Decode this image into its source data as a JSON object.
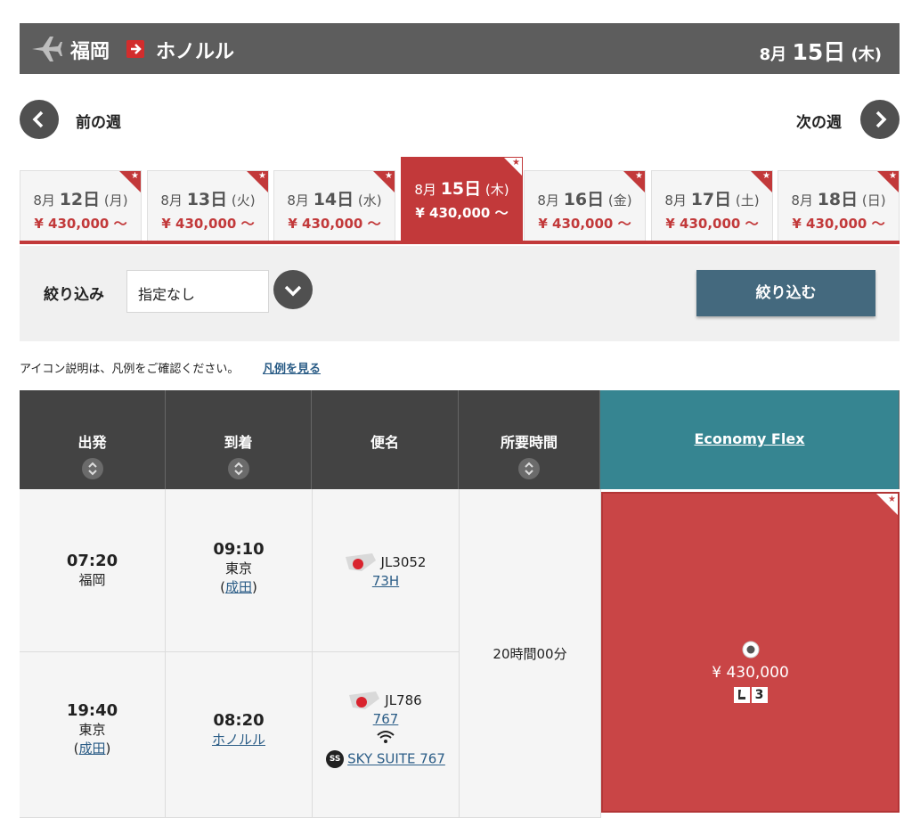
{
  "route": {
    "from": "福岡",
    "to": "ホノルル",
    "date_month": "8月",
    "date_day": "15日",
    "date_weekday": "(木)"
  },
  "week_nav": {
    "prev_label": "前の週",
    "next_label": "次の週"
  },
  "tabs": [
    {
      "month": "8月",
      "day": "12日",
      "weekday": "(月)",
      "price": "¥ 430,000 ～"
    },
    {
      "month": "8月",
      "day": "13日",
      "weekday": "(火)",
      "price": "¥ 430,000 ～"
    },
    {
      "month": "8月",
      "day": "14日",
      "weekday": "(水)",
      "price": "¥ 430,000 ～"
    },
    {
      "month": "8月",
      "day": "15日",
      "weekday": "(木)",
      "price": "¥ 430,000 ～"
    },
    {
      "month": "8月",
      "day": "16日",
      "weekday": "(金)",
      "price": "¥ 430,000 ～"
    },
    {
      "month": "8月",
      "day": "17日",
      "weekday": "(土)",
      "price": "¥ 430,000 ～"
    },
    {
      "month": "8月",
      "day": "18日",
      "weekday": "(日)",
      "price": "¥ 430,000 ～"
    }
  ],
  "filter": {
    "label": "絞り込み",
    "selected": "指定なし",
    "apply_label": "絞り込む"
  },
  "legend": {
    "text": "アイコン説明は、凡例をご確認ください。",
    "link": "凡例を見る"
  },
  "table": {
    "headers": {
      "depart": "出発",
      "arrive": "到着",
      "flight": "便名",
      "duration": "所要時間",
      "fare": "Economy Flex"
    },
    "segments": [
      {
        "depart_time": "07:20",
        "depart_city": "福岡",
        "arrive_time": "09:10",
        "arrive_city": "東京",
        "arrive_airport": "成田",
        "flight_no": "JL3052",
        "aircraft": "73H"
      },
      {
        "depart_time": "19:40",
        "depart_city": "東京",
        "depart_airport": "成田",
        "arrive_time": "08:20",
        "arrive_airport": "ホノルル",
        "flight_no": "JL786",
        "aircraft": "767",
        "seat": "SKY SUITE 767",
        "seat_badge": "SS"
      }
    ],
    "duration": "20時間00分",
    "fare": {
      "price": "¥ 430,000",
      "seats_left": "3"
    }
  },
  "colors": {
    "accent_red": "#c2393a",
    "header_gray": "#5d5d5d",
    "table_header": "#434343",
    "fare_teal": "#368591",
    "apply_blue": "#44697e"
  }
}
